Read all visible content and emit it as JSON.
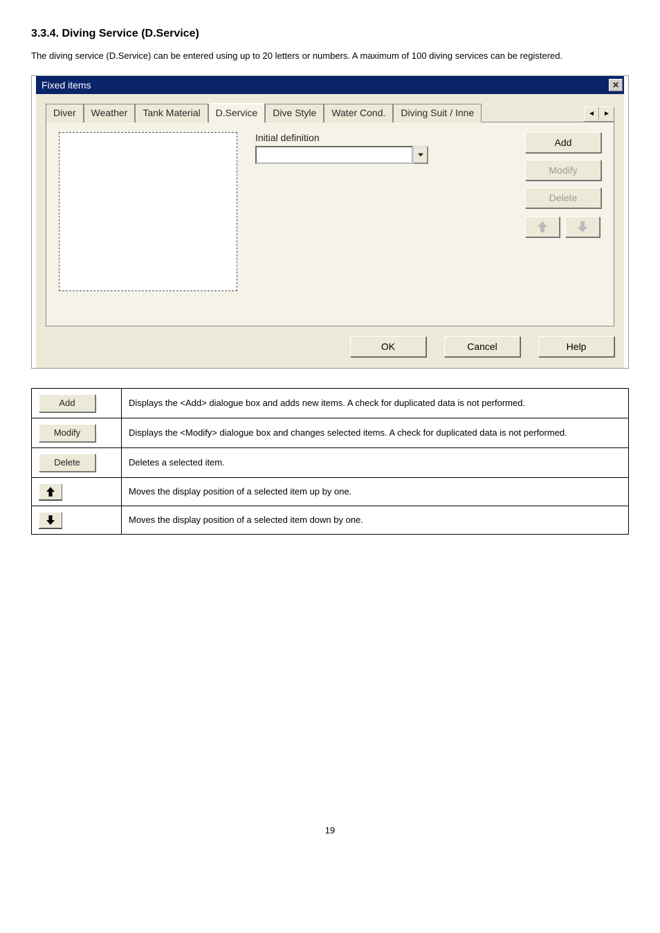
{
  "section": {
    "title": "3.3.4. Diving Service (D.Service)",
    "intro": "The diving service (D.Service) can be entered using up to 20 letters or numbers. A maximum of 100 diving services can be registered."
  },
  "dialog": {
    "title": "Fixed items",
    "tabs": {
      "diver": "Diver",
      "weather": "Weather",
      "tank_material": "Tank Material",
      "d_service": "D.Service",
      "dive_style": "Dive Style",
      "water_cond": "Water Cond.",
      "diving_suit": "Diving Suit / Inne"
    },
    "initial_definition_label": "Initial definition",
    "buttons": {
      "add": "Add",
      "modify": "Modify",
      "delete": "Delete",
      "ok": "OK",
      "cancel": "Cancel",
      "help": "Help"
    }
  },
  "table": {
    "add_label": "Add",
    "add_desc": "Displays the <Add> dialogue box and adds new items. A check for duplicated data is not performed.",
    "modify_label": "Modify",
    "modify_desc": "Displays the <Modify> dialogue box and changes selected items. A check for duplicated data is not performed.",
    "delete_label": "Delete",
    "delete_desc": "Deletes a selected item.",
    "up_desc": "Moves the display position of a selected item up by one.",
    "down_desc": "Moves the display position of a selected item down by one."
  },
  "page_number": "19"
}
